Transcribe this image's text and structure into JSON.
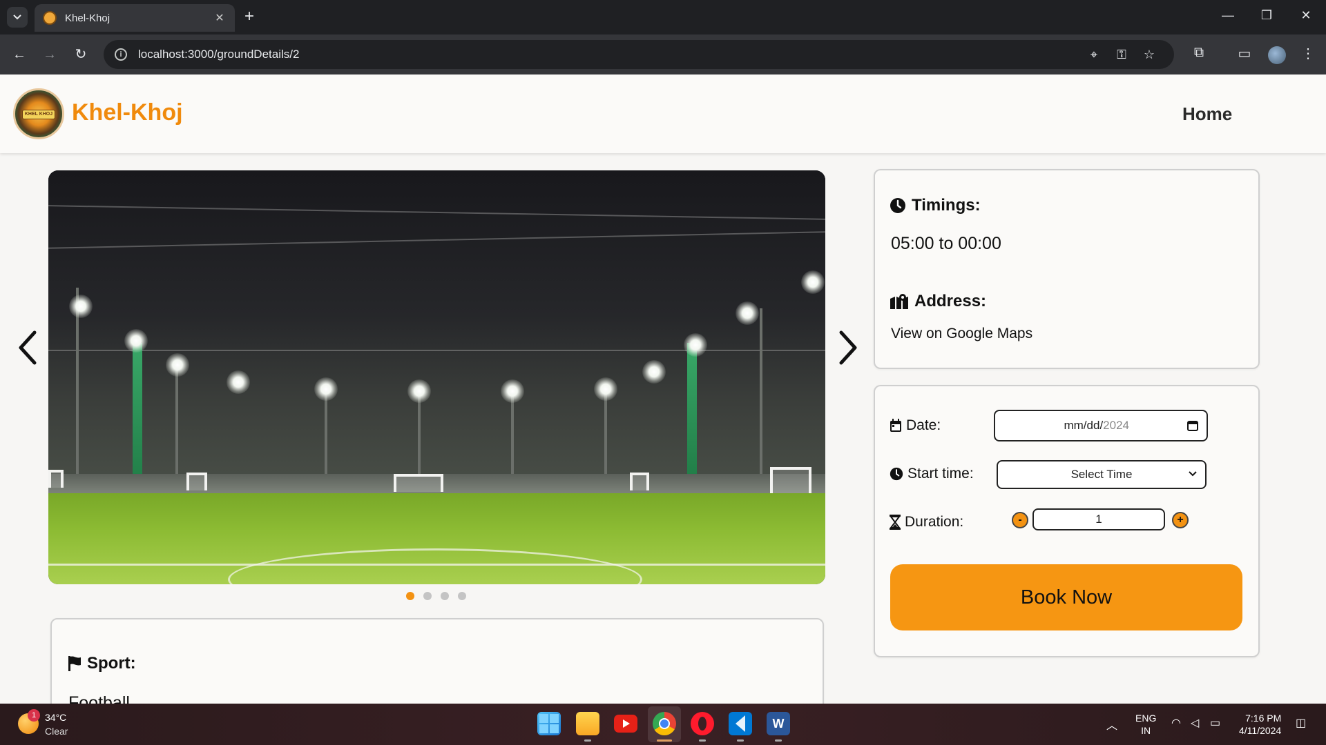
{
  "browser": {
    "tab_title": "Khel-Khoj",
    "url": "localhost:3000/groundDetails/2"
  },
  "site": {
    "brand": "Khel-Khoj",
    "logo_text": "KHEL KHOJ",
    "nav_home": "Home"
  },
  "carousel": {
    "slide_count": 4,
    "active_slide": 1,
    "prev_glyph": "‹",
    "next_glyph": "›"
  },
  "info_card": {
    "timings_label": "Timings:",
    "timings_value": "05:00 to 00:00",
    "address_label": "Address:",
    "maps_link": "View on Google Maps"
  },
  "booking": {
    "date_label": "Date:",
    "date_placeholder_md": "mm/dd/",
    "date_placeholder_year": "2024",
    "start_label": "Start time:",
    "start_value": "Select Time",
    "duration_label": "Duration:",
    "duration_value": "1",
    "minus": "-",
    "plus": "+",
    "book_button": "Book Now"
  },
  "sport_card": {
    "label": "Sport:",
    "value": "Football"
  },
  "taskbar": {
    "weather_temp": "34°C",
    "weather_cond": "Clear",
    "weather_badge": "1",
    "lang_top": "ENG",
    "lang_bottom": "IN",
    "time": "7:16 PM",
    "date": "4/11/2024"
  },
  "colors": {
    "accent": "#f39212",
    "brand_text": "#f08a0c"
  }
}
